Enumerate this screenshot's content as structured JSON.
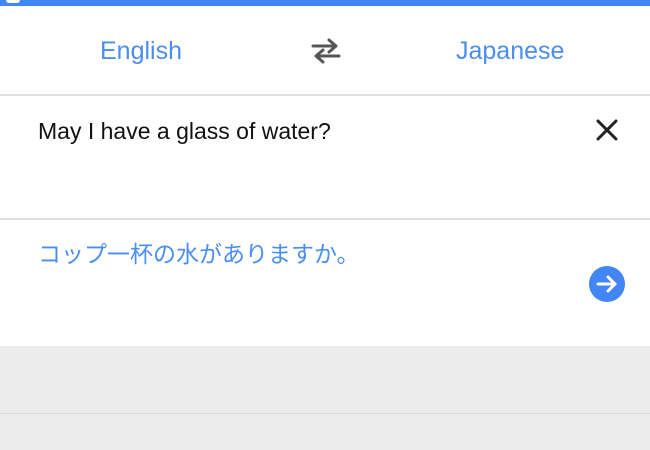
{
  "languages": {
    "source": "English",
    "target": "Japanese"
  },
  "input": {
    "text": "May I have a glass of water?"
  },
  "output": {
    "text": "コップ一杯の水がありますか。"
  },
  "icons": {
    "swap": "swap-arrows-icon",
    "clear": "close-icon",
    "go": "arrow-right-icon"
  },
  "colors": {
    "accent": "#4285f4",
    "link_text": "#4a8ef0",
    "input_text": "#111111",
    "panel_bg": "#ececec"
  }
}
